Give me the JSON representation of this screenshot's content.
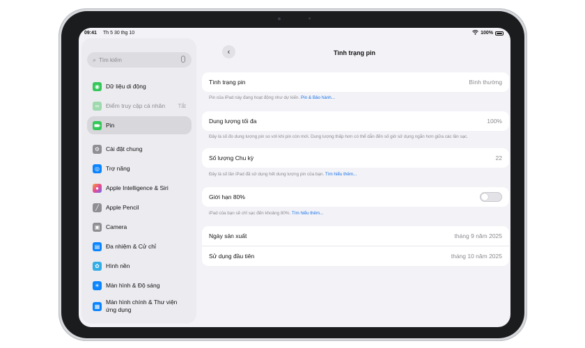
{
  "status_bar": {
    "time": "09:41",
    "date": "Th 5 30 thg 10",
    "battery": "100%"
  },
  "sidebar": {
    "search_placeholder": "Tìm kiếm",
    "items": [
      {
        "label": "Dữ liệu di động",
        "icon": "cellular-icon",
        "color": "#34c759"
      },
      {
        "label": "Điểm truy cập cá nhân",
        "trail": "Tắt",
        "icon": "hotspot-icon",
        "color": "#34c759"
      },
      {
        "label": "Pin",
        "icon": "battery-icon",
        "color": "#34c759"
      },
      {
        "label": "Cài đặt chung",
        "icon": "gear-icon",
        "color": "#8e8e93"
      },
      {
        "label": "Trợ năng",
        "icon": "accessibility-icon",
        "color": "#0a84ff"
      },
      {
        "label": "Apple Intelligence & Siri",
        "icon": "siri-icon",
        "color": "#c86dd7"
      },
      {
        "label": "Apple Pencil",
        "icon": "pencil-icon",
        "color": "#8e8e93"
      },
      {
        "label": "Camera",
        "icon": "camera-icon",
        "color": "#8e8e93"
      },
      {
        "label": "Đa nhiệm & Cử chỉ",
        "icon": "multitasking-icon",
        "color": "#0a84ff"
      },
      {
        "label": "Hình nền",
        "icon": "wallpaper-icon",
        "color": "#32ade6"
      },
      {
        "label": "Màn hình & Độ sáng",
        "icon": "brightness-icon",
        "color": "#0a84ff"
      },
      {
        "label": "Màn hình chính & Thư viện ứng dụng",
        "icon": "home-screen-icon",
        "color": "#0a84ff"
      }
    ]
  },
  "main": {
    "title": "Tình trạng pin",
    "battery_health": {
      "label": "Tình trạng pin",
      "value": "Bình thường",
      "note": "Pin của iPad này đang hoạt động như dự kiến.",
      "note_link": "Pin & Bảo hành..."
    },
    "max_capacity": {
      "label": "Dung lượng tối đa",
      "value": "100%",
      "note": "Đây là số đo dung lượng pin so với khi pin còn mới. Dung lượng thấp hơn có thể dẫn đến số giờ sử dụng ngắn hơn giữa các lần sạc."
    },
    "cycle_count": {
      "label": "Số lượng Chu kỳ",
      "value": "22",
      "note": "Đây là số lần iPad đã sử dụng hết dung lượng pin của bạn.",
      "note_link": "Tìm hiểu thêm..."
    },
    "limit_80": {
      "label": "Giới hạn 80%",
      "enabled": false,
      "note": "iPad của bạn sẽ chỉ sạc đến khoảng 80%.",
      "note_link": "Tìm hiểu thêm..."
    },
    "dates": [
      {
        "label": "Ngày sản xuất",
        "value": "tháng 9 năm 2025"
      },
      {
        "label": "Sử dụng đầu tiên",
        "value": "tháng 10 năm 2025"
      }
    ]
  }
}
